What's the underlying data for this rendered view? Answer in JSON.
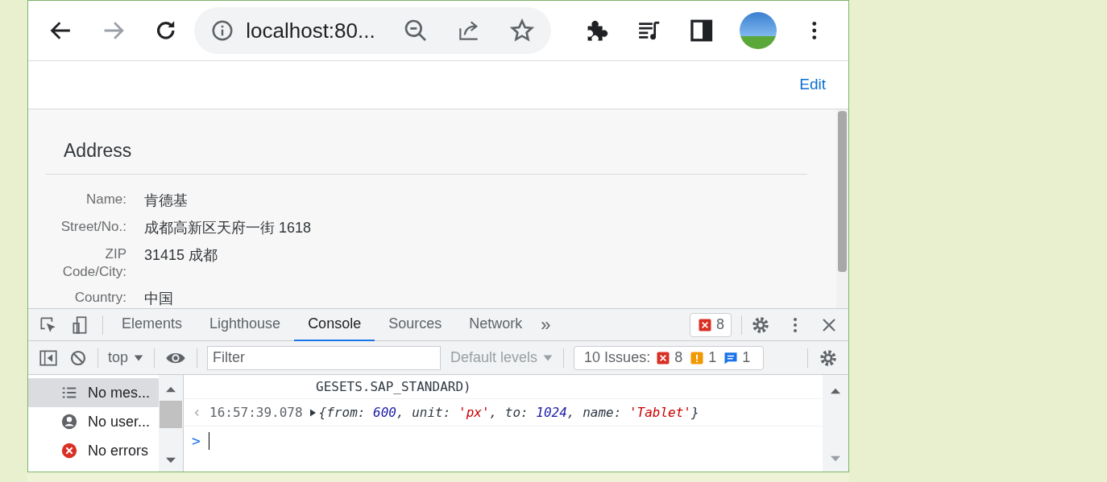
{
  "browser": {
    "url": "localhost:80...",
    "forward_disabled": true
  },
  "page": {
    "edit_link": "Edit",
    "section_title": "Address",
    "fields": [
      {
        "label": "Name:",
        "value": "肯德基"
      },
      {
        "label": "Street/No.:",
        "value": "成都高新区天府一街 1618"
      },
      {
        "label": "ZIP Code/City:",
        "value": "31415 成都"
      },
      {
        "label": "Country:",
        "value": "中国"
      }
    ]
  },
  "devtools": {
    "tabs": [
      {
        "label": "Elements",
        "selected": false
      },
      {
        "label": "Lighthouse",
        "selected": false
      },
      {
        "label": "Console",
        "selected": true
      },
      {
        "label": "Sources",
        "selected": false
      },
      {
        "label": "Network",
        "selected": false
      }
    ],
    "more_tabs": "»",
    "error_count": "8",
    "context": "top",
    "filter_placeholder": "Filter",
    "levels": "Default levels",
    "issues": {
      "label": "10 Issues:",
      "counts": [
        {
          "kind": "error",
          "count": "8"
        },
        {
          "kind": "warning",
          "count": "1"
        },
        {
          "kind": "info",
          "count": "1"
        }
      ]
    },
    "sidebar": [
      {
        "kind": "messages",
        "label": "No mes...",
        "selected": true
      },
      {
        "kind": "user",
        "label": "No user...",
        "selected": false
      },
      {
        "kind": "errors",
        "label": "No errors",
        "selected": false
      }
    ],
    "messages": [
      {
        "tokens": [
          {
            "kind": "plain",
            "text": "GESETS.SAP_STANDARD)"
          }
        ]
      },
      {
        "timestamp": "16:57:39.078",
        "tokens": [
          {
            "kind": "plain",
            "text": "{from: "
          },
          {
            "kind": "number",
            "text": "600"
          },
          {
            "kind": "plain",
            "text": ", unit: "
          },
          {
            "kind": "string",
            "text": "'px'"
          },
          {
            "kind": "plain",
            "text": ", to: "
          },
          {
            "kind": "number",
            "text": "1024"
          },
          {
            "kind": "plain",
            "text": ", name: "
          },
          {
            "kind": "string",
            "text": "'Tablet'"
          },
          {
            "kind": "plain",
            "text": "}"
          }
        ]
      }
    ],
    "prompt": ">"
  }
}
